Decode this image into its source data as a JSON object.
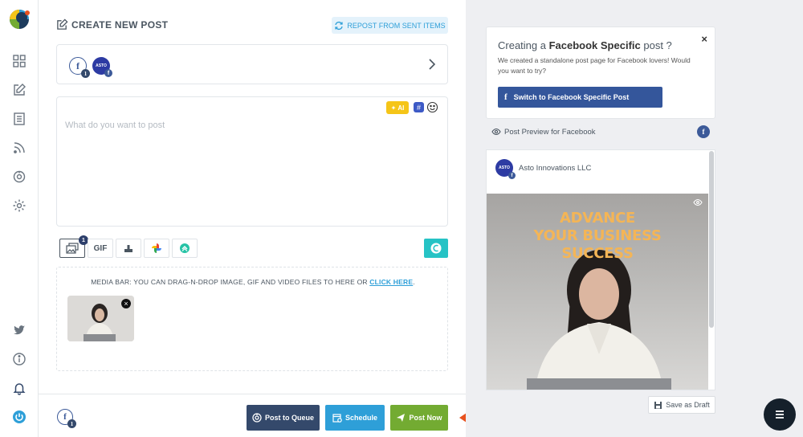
{
  "header": {
    "title": "CREATE NEW POST",
    "repost_label": "REPOST FROM SENT ITEMS"
  },
  "accounts": {
    "facebook_count": "1",
    "avatar_text": "ASTO"
  },
  "editor": {
    "placeholder": "What do you want to post",
    "ai_label": "AI"
  },
  "media_toolbar": {
    "gif_label": "GIF",
    "media_count": "1"
  },
  "media_bar": {
    "text": "MEDIA BAR: YOU CAN DRAG-N-DROP IMAGE, GIF AND VIDEO FILES TO HERE OR",
    "link": "CLICK HERE",
    "period": ".",
    "close_glyph": "×"
  },
  "footer": {
    "account_count": "1",
    "queue_label": "Post to Queue",
    "schedule_label": "Schedule",
    "postnow_label": "Post Now"
  },
  "fb_card": {
    "title_prefix": "Creating a ",
    "title_bold": "Facebook Specific",
    "title_suffix": " post ?",
    "close_glyph": "×",
    "description": "We created a standalone post page for Facebook lovers! Would you want to try?",
    "switch_label": "Switch to Facebook Specific Post"
  },
  "preview": {
    "label": "Post Preview for Facebook",
    "page_name": "Asto Innovations LLC",
    "headline_line1": "ADVANCE",
    "headline_line2": "YOUR BUSINESS",
    "headline_line3": "SUCCESS"
  },
  "draft_label": "Save as Draft",
  "colors": {
    "queue": "#34496b",
    "schedule": "#2e9fd8",
    "postnow": "#73ab32",
    "facebook": "#3c5a99",
    "arrow": "#e8521f"
  }
}
